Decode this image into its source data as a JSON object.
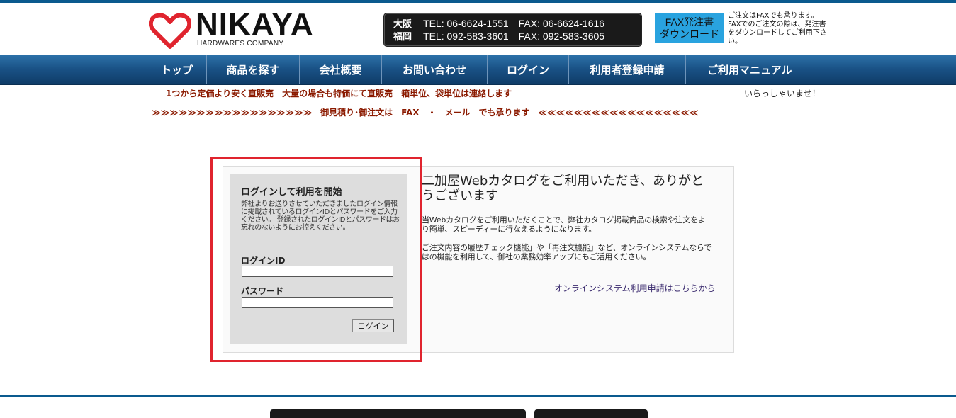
{
  "header": {
    "logo_name": "NIKAYA",
    "logo_sub": "HARDWARES COMPANY",
    "contact": {
      "osaka": {
        "city": "大阪",
        "tel": "TEL: 06-6624-1551",
        "fax": "FAX: 06-6624-1616"
      },
      "fukuoka": {
        "city": "福岡",
        "tel": "TEL: 092-583-3601",
        "fax": "FAX: 092-583-3605"
      }
    },
    "fax_button": {
      "line1": "FAX発注書",
      "line2": "ダウンロード"
    },
    "fax_note": "ご注文はFAXでも承ります。FAXでのご注文の際は、発注書をダウンロードしてご利用下さい。"
  },
  "nav": [
    "トップ",
    "商品を探す",
    "会社概要",
    "お問い合わせ",
    "ログイン",
    "利用者登録申請",
    "ご利用マニュアル"
  ],
  "notice": "1つから定価より安く直販売　大量の場合も特価にて直販売　箱単位、袋単位は連絡します",
  "welcome_user": "いらっしゃいませ！",
  "marquee": "≫≫≫≫≫≫≫≫≫≫≫≫≫≫≫≫≫≫　御見積り･御注文は　FAX　・　メール　でも承ります　≪≪≪≪≪≪≪≪≪≪≪≪≪≪≪≪≪≪",
  "login": {
    "title": "ログインして利用を開始",
    "description": "弊社よりお送りさせていただきましたログイン情報に掲載されているログインIDとパスワードをご入力ください。 登録されたログインIDとパスワードはお忘れのないようにお控えください。",
    "id_label": "ログインID",
    "id_value": "",
    "password_label": "パスワード",
    "password_value": "",
    "button_label": "ログイン"
  },
  "welcome": {
    "title": "二加屋Webカタログをご利用いただき、ありがとうございます",
    "p1": "当Webカタログをご利用いただくことで、弊社カタログ掲載商品の検索や注文をより簡単、スピーディーに行なえるようになります。",
    "p2": "ご注文内容の履歴チェック機能」や「再注文機能」など、オンラインシステムならではの機能を利用して、御社の業務効率アップにもご活用ください。",
    "apply_link": "オンラインシステム利用申請はこちらから"
  },
  "colors": {
    "brand_blue": "#0a5a8e",
    "logo_red": "#e0242e",
    "notice_red": "#8b1a00",
    "fax_button": "#29a3df",
    "highlight": "#e0242e"
  }
}
